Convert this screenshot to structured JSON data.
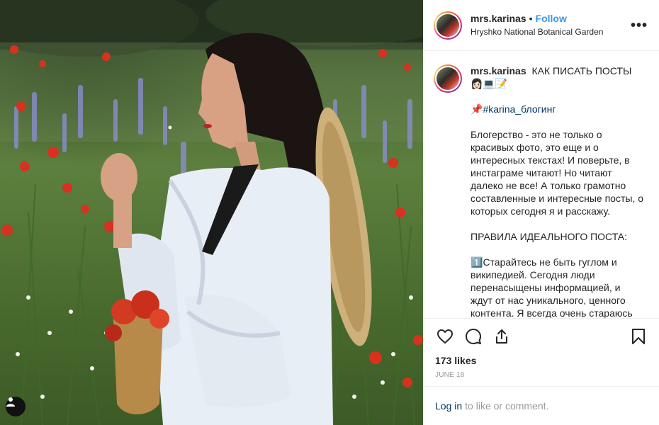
{
  "post": {
    "username": "mrs.karinas",
    "separator": "•",
    "follow_label": "Follow",
    "location": "Hryshko National Botanical Garden",
    "more_label": "•••"
  },
  "caption": {
    "username": "mrs.karinas",
    "title": "КАК ПИСАТЬ ПОСТЫ",
    "title_emojis": "👩🏻💻📝",
    "hashtag_line_pin": "📌",
    "hashtag": "#karina_блогинг",
    "paragraph1": "Блогерство - это не только о красивых фото, это еще и о интересных текстах! И поверьте, в инстаграме читают! Но читают далеко не все! А только грамотно составленные и интересные посты, о которых сегодня я и расскажу.",
    "paragraph2": "ПРАВИЛА ИДЕАЛЬНОГО ПОСТА:",
    "paragraph3_number": "1️⃣",
    "paragraph3": "Старайтесь не быть гуглом и википедией. Сегодня люди перенасыщены информацией, и ждут от нас уникального, ценного контента. Я всегда очень стараюсь"
  },
  "actions": {
    "like_icon": "heart-outline",
    "comment_icon": "speech-bubble",
    "share_icon": "share-upload",
    "save_icon": "bookmark-outline",
    "likes_text": "173 likes",
    "date_text": "JUNE 18"
  },
  "login": {
    "link_text": "Log in",
    "rest_text": "to like or comment."
  },
  "photo": {
    "user_tag_icon": "person-icon"
  }
}
